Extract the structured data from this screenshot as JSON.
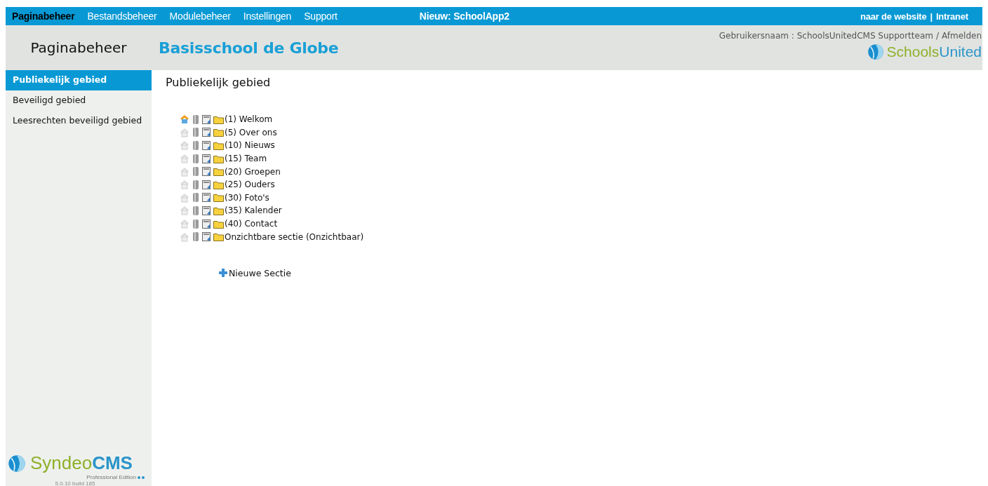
{
  "top_nav": {
    "items": [
      {
        "label": "Paginabeheer",
        "selected": true
      },
      {
        "label": "Bestandsbeheer",
        "selected": false
      },
      {
        "label": "Modulebeheer",
        "selected": false
      },
      {
        "label": "Instellingen",
        "selected": false
      },
      {
        "label": "Support",
        "selected": false
      }
    ],
    "announcement": "Nieuw: SchoolApp2",
    "right_links": [
      "naar de website",
      "Intranet"
    ],
    "separator": "|"
  },
  "header": {
    "section_title": "Paginabeheer",
    "site_title": "Basisschool de Globe",
    "user_label": "Gebruikersnaam : SchoolsUnitedCMS Supportteam",
    "user_separator": "/",
    "logout": "Afmelden",
    "logo": {
      "part_1": "Schools",
      "part_2": "United"
    }
  },
  "sidebar": {
    "items": [
      {
        "label": "Publiekelijk gebied",
        "selected": true
      },
      {
        "label": "Beveiligd gebied",
        "selected": false
      },
      {
        "label": "Leesrechten beveiligd gebied",
        "selected": false
      }
    ],
    "logo": {
      "part_1": "Syndeo",
      "part_2": "CMS",
      "edition": "Professional Edition",
      "version": "5.0.10 build 185"
    }
  },
  "content": {
    "title": "Publiekelijk gebied",
    "tree": [
      {
        "label": "(1) Welkom",
        "active": true
      },
      {
        "label": "(5) Over ons",
        "active": false
      },
      {
        "label": "(10) Nieuws",
        "active": false
      },
      {
        "label": "(15) Team",
        "active": false
      },
      {
        "label": "(20) Groepen",
        "active": false
      },
      {
        "label": "(25) Ouders",
        "active": false
      },
      {
        "label": "(30) Foto's",
        "active": false
      },
      {
        "label": "(35) Kalender",
        "active": false
      },
      {
        "label": "(40) Contact",
        "active": false
      },
      {
        "label": "Onzichtbare sectie (Onzichtbaar)",
        "active": false
      }
    ],
    "new_section": "Nieuwe Sectie"
  }
}
